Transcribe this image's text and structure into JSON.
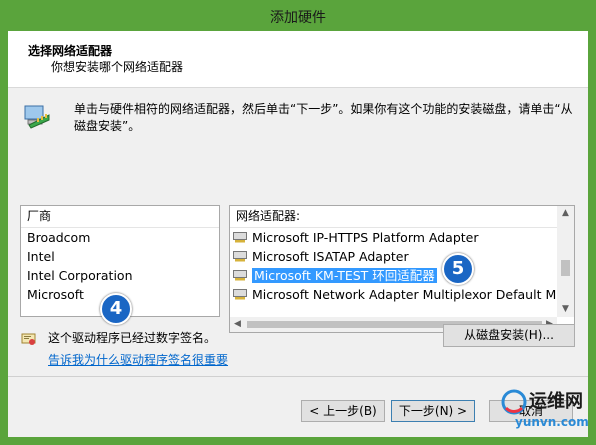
{
  "window": {
    "title": "添加硬件"
  },
  "header": {
    "title": "选择网络适配器",
    "subtitle": "你想安装哪个网络适配器"
  },
  "intro": {
    "text": "单击与硬件相符的网络适配器，然后单击“下一步”。如果你有这个功能的安装磁盘，请单击“从磁盘安装”。"
  },
  "manufacturers": {
    "header": "厂商",
    "items": [
      "Broadcom",
      "Intel",
      "Intel Corporation",
      "Microsoft"
    ]
  },
  "adapters": {
    "header": "网络适配器:",
    "items": [
      "Microsoft IP-HTTPS Platform Adapter",
      "Microsoft ISATAP Adapter",
      "Microsoft KM-TEST 环回适配器",
      "Microsoft Network Adapter Multiplexor Default Mini"
    ],
    "selected_index": 2
  },
  "badges": {
    "left": "4",
    "right": "5"
  },
  "signed": {
    "text": "这个驱动程序已经过数字签名。"
  },
  "link": {
    "text": "告诉我为什么驱动程序签名很重要"
  },
  "buttons": {
    "have_disk": "从磁盘安装(H)...",
    "back": "< 上一步(B)",
    "next": "下一步(N) >",
    "cancel": "取消"
  },
  "watermark": {
    "cn": "运维网",
    "url": "yunvn.com"
  }
}
